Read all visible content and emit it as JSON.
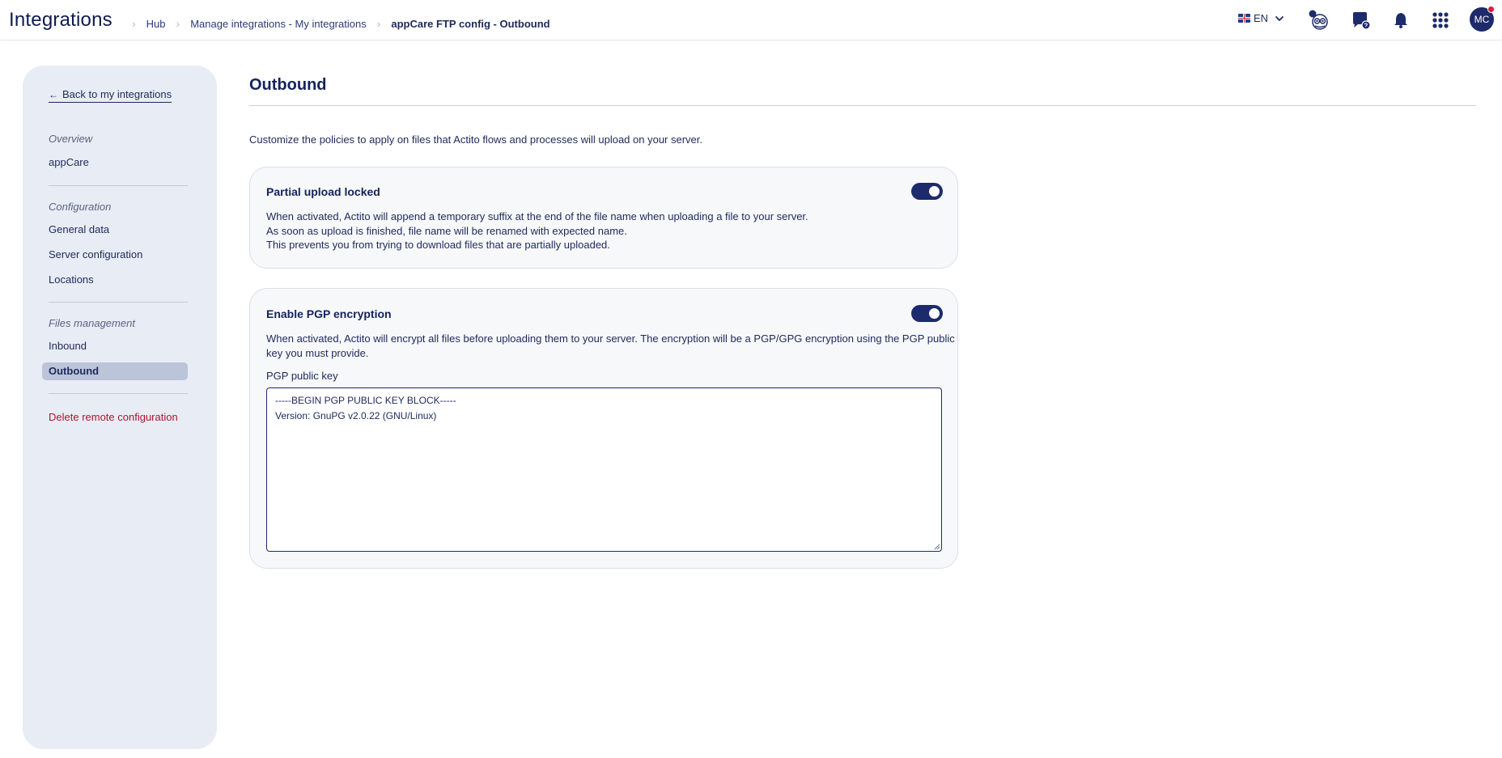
{
  "header": {
    "app_title": "Integrations",
    "breadcrumb": {
      "hub": "Hub",
      "manage": "Manage integrations - My integrations",
      "current": "appCare FTP config - Outbound"
    },
    "language": "EN",
    "avatar_initials": "MC",
    "icons": [
      "flag-uk-icon",
      "chevron-down-icon",
      "owl-assistant-icon",
      "chat-icon",
      "bell-icon",
      "apps-grid-icon"
    ]
  },
  "sidebar": {
    "back_label": "Back to my integrations",
    "overview_label": "Overview",
    "overview_item": "appCare",
    "config_label": "Configuration",
    "config_items": [
      "General data",
      "Server configuration",
      "Locations"
    ],
    "files_label": "Files management",
    "files_items": [
      "Inbound",
      "Outbound"
    ],
    "delete_label": "Delete remote configuration"
  },
  "main": {
    "title": "Outbound",
    "intro": "Customize the policies to apply on files that Actito flows and processes will upload on your server.",
    "partial_upload": {
      "title": "Partial upload locked",
      "enabled": true,
      "lines": [
        "When activated, Actito will append a temporary suffix at the end of the file name when uploading a file to your server.",
        "As soon as upload is finished, file name will be renamed with expected name.",
        "This prevents you from trying to download files that are partially uploaded."
      ]
    },
    "pgp": {
      "title": "Enable PGP encryption",
      "enabled": true,
      "line1": "When activated, Actito will encrypt all files before uploading them to your server. The encryption will be a PGP/GPG encryption using the PGP public",
      "line2": "key you must provide.",
      "key_label": "PGP public key",
      "key_value": "-----BEGIN PGP PUBLIC KEY BLOCK-----\nVersion: GnuPG v2.0.22 (GNU/Linux)"
    }
  },
  "colors": {
    "accent": "#1d2a6b",
    "text": "#1d2a5b",
    "sidebar_bg": "#e8ecf4",
    "sidebar_active": "#bcc4d9",
    "danger": "#b0142e",
    "notification_dot": "#d6203a"
  }
}
